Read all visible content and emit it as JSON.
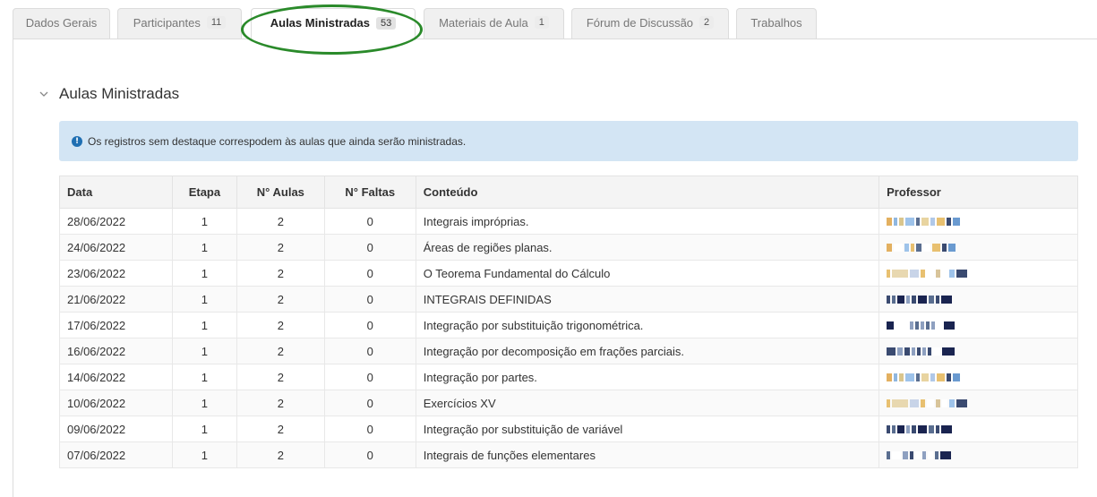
{
  "tabs": [
    {
      "label": "Dados Gerais",
      "count": ""
    },
    {
      "label": "Participantes",
      "count": "11"
    },
    {
      "label": "Aulas Ministradas",
      "count": "53"
    },
    {
      "label": "Materiais de Aula",
      "count": "1"
    },
    {
      "label": "Fórum de Discussão",
      "count": "2"
    },
    {
      "label": "Trabalhos",
      "count": ""
    }
  ],
  "section": {
    "title": "Aulas Ministradas"
  },
  "alert": {
    "text": "Os registros sem destaque correspodem às aulas que ainda serão ministradas."
  },
  "table": {
    "headers": [
      "Data",
      "Etapa",
      "N° Aulas",
      "N° Faltas",
      "Conteúdo",
      "Professor"
    ],
    "rows": [
      {
        "data": "28/06/2022",
        "etapa": "1",
        "aulas": "2",
        "faltas": "0",
        "conteudo": "Integrais impróprias."
      },
      {
        "data": "24/06/2022",
        "etapa": "1",
        "aulas": "2",
        "faltas": "0",
        "conteudo": "Áreas de regiões planas."
      },
      {
        "data": "23/06/2022",
        "etapa": "1",
        "aulas": "2",
        "faltas": "0",
        "conteudo": "O Teorema Fundamental do Cálculo"
      },
      {
        "data": "21/06/2022",
        "etapa": "1",
        "aulas": "2",
        "faltas": "0",
        "conteudo": "INTEGRAIS DEFINIDAS"
      },
      {
        "data": "17/06/2022",
        "etapa": "1",
        "aulas": "2",
        "faltas": "0",
        "conteudo": "Integração por substituição trigonométrica."
      },
      {
        "data": "16/06/2022",
        "etapa": "1",
        "aulas": "2",
        "faltas": "0",
        "conteudo": "Integração por decomposição em frações parciais."
      },
      {
        "data": "14/06/2022",
        "etapa": "1",
        "aulas": "2",
        "faltas": "0",
        "conteudo": "Integração por partes."
      },
      {
        "data": "10/06/2022",
        "etapa": "1",
        "aulas": "2",
        "faltas": "0",
        "conteudo": "Exercícios XV"
      },
      {
        "data": "09/06/2022",
        "etapa": "1",
        "aulas": "2",
        "faltas": "0",
        "conteudo": "Integração por substituição de variável"
      },
      {
        "data": "07/06/2022",
        "etapa": "1",
        "aulas": "2",
        "faltas": "0",
        "conteudo": "Integrais de funções elementares"
      }
    ]
  },
  "colors": {
    "accent_circle": "#2a8a2a",
    "alert_bg": "#d3e5f4",
    "info_icon": "#1f6fb2"
  }
}
